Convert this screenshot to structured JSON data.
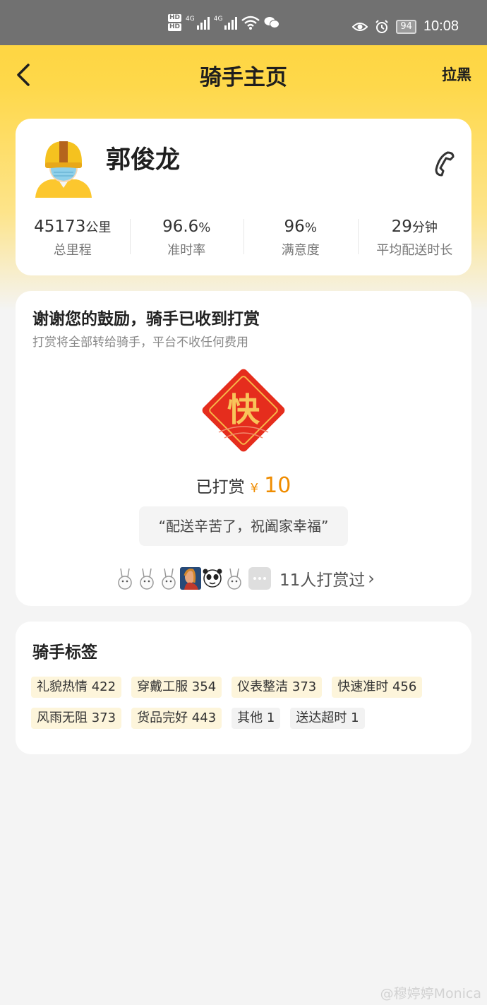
{
  "status_bar": {
    "hd1": "HD",
    "hd2": "HD",
    "net1": "4G",
    "net2": "4G",
    "battery": "94",
    "time": "10:08"
  },
  "nav": {
    "title": "骑手主页",
    "right_action": "拉黑"
  },
  "rider": {
    "name": "郭俊龙",
    "stats": [
      {
        "value": "45173",
        "unit": "公里",
        "label": "总里程"
      },
      {
        "value": "96.6",
        "unit": "%",
        "label": "准时率"
      },
      {
        "value": "96",
        "unit": "%",
        "label": "满意度"
      },
      {
        "value": "29",
        "unit": "分钟",
        "label": "平均配送时长"
      }
    ]
  },
  "tip": {
    "heading": "谢谢您的鼓励，骑手已收到打赏",
    "subheading": "打赏将全部转给骑手，平台不收任何费用",
    "badge_char": "快",
    "tipped_label": "已打赏",
    "currency": "¥",
    "amount": "10",
    "message": "“配送辛苦了，祝阖家幸福”",
    "givers_text": "11人打赏过",
    "chevron": "›"
  },
  "tags": {
    "heading": "骑手标签",
    "rows": [
      [
        {
          "text": "礼貌热情 422",
          "kind": "pos"
        },
        {
          "text": "穿戴工服 354",
          "kind": "pos"
        },
        {
          "text": "仪表整洁 373",
          "kind": "pos"
        },
        {
          "text": "快速准时 456",
          "kind": "pos"
        }
      ],
      [
        {
          "text": "风雨无阻 373",
          "kind": "pos"
        },
        {
          "text": "货品完好 443",
          "kind": "pos"
        },
        {
          "text": "其他 1",
          "kind": "neg"
        },
        {
          "text": "送达超时 1",
          "kind": "neg"
        }
      ]
    ]
  },
  "watermark": "@穆婷婷Monica",
  "colors": {
    "brand_yellow": "#fdd33a",
    "tip_orange": "#ef8c00",
    "badge_red": "#e52d1d"
  }
}
